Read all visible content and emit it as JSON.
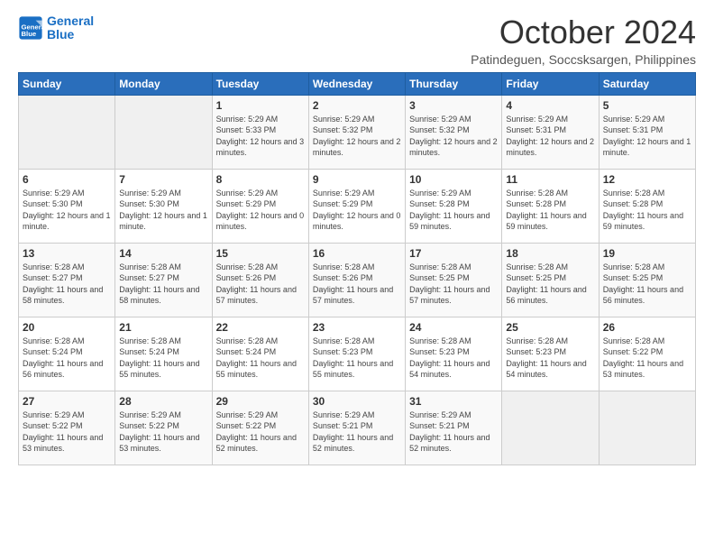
{
  "logo": {
    "text_general": "General",
    "text_blue": "Blue"
  },
  "header": {
    "month": "October 2024",
    "location": "Patindeguen, Soccsksargen, Philippines"
  },
  "weekdays": [
    "Sunday",
    "Monday",
    "Tuesday",
    "Wednesday",
    "Thursday",
    "Friday",
    "Saturday"
  ],
  "weeks": [
    [
      {
        "day": "",
        "sunrise": "",
        "sunset": "",
        "daylight": ""
      },
      {
        "day": "",
        "sunrise": "",
        "sunset": "",
        "daylight": ""
      },
      {
        "day": "1",
        "sunrise": "Sunrise: 5:29 AM",
        "sunset": "Sunset: 5:33 PM",
        "daylight": "Daylight: 12 hours and 3 minutes."
      },
      {
        "day": "2",
        "sunrise": "Sunrise: 5:29 AM",
        "sunset": "Sunset: 5:32 PM",
        "daylight": "Daylight: 12 hours and 2 minutes."
      },
      {
        "day": "3",
        "sunrise": "Sunrise: 5:29 AM",
        "sunset": "Sunset: 5:32 PM",
        "daylight": "Daylight: 12 hours and 2 minutes."
      },
      {
        "day": "4",
        "sunrise": "Sunrise: 5:29 AM",
        "sunset": "Sunset: 5:31 PM",
        "daylight": "Daylight: 12 hours and 2 minutes."
      },
      {
        "day": "5",
        "sunrise": "Sunrise: 5:29 AM",
        "sunset": "Sunset: 5:31 PM",
        "daylight": "Daylight: 12 hours and 1 minute."
      }
    ],
    [
      {
        "day": "6",
        "sunrise": "Sunrise: 5:29 AM",
        "sunset": "Sunset: 5:30 PM",
        "daylight": "Daylight: 12 hours and 1 minute."
      },
      {
        "day": "7",
        "sunrise": "Sunrise: 5:29 AM",
        "sunset": "Sunset: 5:30 PM",
        "daylight": "Daylight: 12 hours and 1 minute."
      },
      {
        "day": "8",
        "sunrise": "Sunrise: 5:29 AM",
        "sunset": "Sunset: 5:29 PM",
        "daylight": "Daylight: 12 hours and 0 minutes."
      },
      {
        "day": "9",
        "sunrise": "Sunrise: 5:29 AM",
        "sunset": "Sunset: 5:29 PM",
        "daylight": "Daylight: 12 hours and 0 minutes."
      },
      {
        "day": "10",
        "sunrise": "Sunrise: 5:29 AM",
        "sunset": "Sunset: 5:28 PM",
        "daylight": "Daylight: 11 hours and 59 minutes."
      },
      {
        "day": "11",
        "sunrise": "Sunrise: 5:28 AM",
        "sunset": "Sunset: 5:28 PM",
        "daylight": "Daylight: 11 hours and 59 minutes."
      },
      {
        "day": "12",
        "sunrise": "Sunrise: 5:28 AM",
        "sunset": "Sunset: 5:28 PM",
        "daylight": "Daylight: 11 hours and 59 minutes."
      }
    ],
    [
      {
        "day": "13",
        "sunrise": "Sunrise: 5:28 AM",
        "sunset": "Sunset: 5:27 PM",
        "daylight": "Daylight: 11 hours and 58 minutes."
      },
      {
        "day": "14",
        "sunrise": "Sunrise: 5:28 AM",
        "sunset": "Sunset: 5:27 PM",
        "daylight": "Daylight: 11 hours and 58 minutes."
      },
      {
        "day": "15",
        "sunrise": "Sunrise: 5:28 AM",
        "sunset": "Sunset: 5:26 PM",
        "daylight": "Daylight: 11 hours and 57 minutes."
      },
      {
        "day": "16",
        "sunrise": "Sunrise: 5:28 AM",
        "sunset": "Sunset: 5:26 PM",
        "daylight": "Daylight: 11 hours and 57 minutes."
      },
      {
        "day": "17",
        "sunrise": "Sunrise: 5:28 AM",
        "sunset": "Sunset: 5:25 PM",
        "daylight": "Daylight: 11 hours and 57 minutes."
      },
      {
        "day": "18",
        "sunrise": "Sunrise: 5:28 AM",
        "sunset": "Sunset: 5:25 PM",
        "daylight": "Daylight: 11 hours and 56 minutes."
      },
      {
        "day": "19",
        "sunrise": "Sunrise: 5:28 AM",
        "sunset": "Sunset: 5:25 PM",
        "daylight": "Daylight: 11 hours and 56 minutes."
      }
    ],
    [
      {
        "day": "20",
        "sunrise": "Sunrise: 5:28 AM",
        "sunset": "Sunset: 5:24 PM",
        "daylight": "Daylight: 11 hours and 56 minutes."
      },
      {
        "day": "21",
        "sunrise": "Sunrise: 5:28 AM",
        "sunset": "Sunset: 5:24 PM",
        "daylight": "Daylight: 11 hours and 55 minutes."
      },
      {
        "day": "22",
        "sunrise": "Sunrise: 5:28 AM",
        "sunset": "Sunset: 5:24 PM",
        "daylight": "Daylight: 11 hours and 55 minutes."
      },
      {
        "day": "23",
        "sunrise": "Sunrise: 5:28 AM",
        "sunset": "Sunset: 5:23 PM",
        "daylight": "Daylight: 11 hours and 55 minutes."
      },
      {
        "day": "24",
        "sunrise": "Sunrise: 5:28 AM",
        "sunset": "Sunset: 5:23 PM",
        "daylight": "Daylight: 11 hours and 54 minutes."
      },
      {
        "day": "25",
        "sunrise": "Sunrise: 5:28 AM",
        "sunset": "Sunset: 5:23 PM",
        "daylight": "Daylight: 11 hours and 54 minutes."
      },
      {
        "day": "26",
        "sunrise": "Sunrise: 5:28 AM",
        "sunset": "Sunset: 5:22 PM",
        "daylight": "Daylight: 11 hours and 53 minutes."
      }
    ],
    [
      {
        "day": "27",
        "sunrise": "Sunrise: 5:29 AM",
        "sunset": "Sunset: 5:22 PM",
        "daylight": "Daylight: 11 hours and 53 minutes."
      },
      {
        "day": "28",
        "sunrise": "Sunrise: 5:29 AM",
        "sunset": "Sunset: 5:22 PM",
        "daylight": "Daylight: 11 hours and 53 minutes."
      },
      {
        "day": "29",
        "sunrise": "Sunrise: 5:29 AM",
        "sunset": "Sunset: 5:22 PM",
        "daylight": "Daylight: 11 hours and 52 minutes."
      },
      {
        "day": "30",
        "sunrise": "Sunrise: 5:29 AM",
        "sunset": "Sunset: 5:21 PM",
        "daylight": "Daylight: 11 hours and 52 minutes."
      },
      {
        "day": "31",
        "sunrise": "Sunrise: 5:29 AM",
        "sunset": "Sunset: 5:21 PM",
        "daylight": "Daylight: 11 hours and 52 minutes."
      },
      {
        "day": "",
        "sunrise": "",
        "sunset": "",
        "daylight": ""
      },
      {
        "day": "",
        "sunrise": "",
        "sunset": "",
        "daylight": ""
      }
    ]
  ]
}
